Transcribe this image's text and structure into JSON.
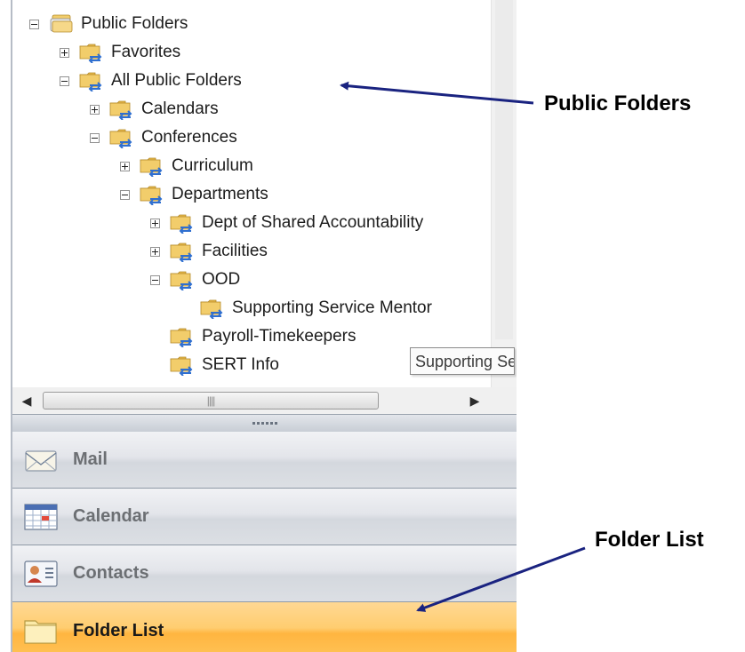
{
  "tree": {
    "nodes": [
      {
        "label": "Public Folders",
        "level": 0,
        "expander": "minus",
        "icon": "public-folders-root-icon"
      },
      {
        "label": "Favorites",
        "level": 1,
        "expander": "plus",
        "icon": "public-folder-icon"
      },
      {
        "label": "All Public Folders",
        "level": 1,
        "expander": "minus",
        "icon": "public-folder-icon"
      },
      {
        "label": "Calendars",
        "level": 2,
        "expander": "plus",
        "icon": "public-folder-icon"
      },
      {
        "label": "Conferences",
        "level": 2,
        "expander": "minus",
        "icon": "public-folder-icon"
      },
      {
        "label": "Curriculum",
        "level": 3,
        "expander": "plus",
        "icon": "public-folder-icon"
      },
      {
        "label": "Departments",
        "level": 3,
        "expander": "minus",
        "icon": "public-folder-icon"
      },
      {
        "label": "Dept of Shared Accountability",
        "level": 4,
        "expander": "plus",
        "icon": "public-folder-icon"
      },
      {
        "label": "Facilities",
        "level": 4,
        "expander": "plus",
        "icon": "public-folder-icon"
      },
      {
        "label": "OOD",
        "level": 4,
        "expander": "minus",
        "icon": "public-folder-icon"
      },
      {
        "label": "Supporting Service Mentor",
        "level": 5,
        "expander": "none",
        "icon": "public-folder-icon"
      },
      {
        "label": "Payroll-Timekeepers",
        "level": 4,
        "expander": "none",
        "icon": "public-folder-icon"
      },
      {
        "label": "SERT Info",
        "level": 4,
        "expander": "none",
        "icon": "public-folder-icon"
      }
    ],
    "tooltip": "Supporting Service Mentor"
  },
  "nav": {
    "buttons": [
      {
        "label": "Mail",
        "icon": "mail-icon",
        "active": false
      },
      {
        "label": "Calendar",
        "icon": "calendar-icon",
        "active": false
      },
      {
        "label": "Contacts",
        "icon": "contacts-icon",
        "active": false
      },
      {
        "label": "Folder List",
        "icon": "folder-list-icon",
        "active": true
      }
    ]
  },
  "annotations": {
    "public_folders": "Public Folders",
    "folder_list": "Folder List"
  },
  "colors": {
    "active_nav": "#ffc458",
    "arrow": "#1a2380",
    "folder": "#f2cd6b"
  }
}
